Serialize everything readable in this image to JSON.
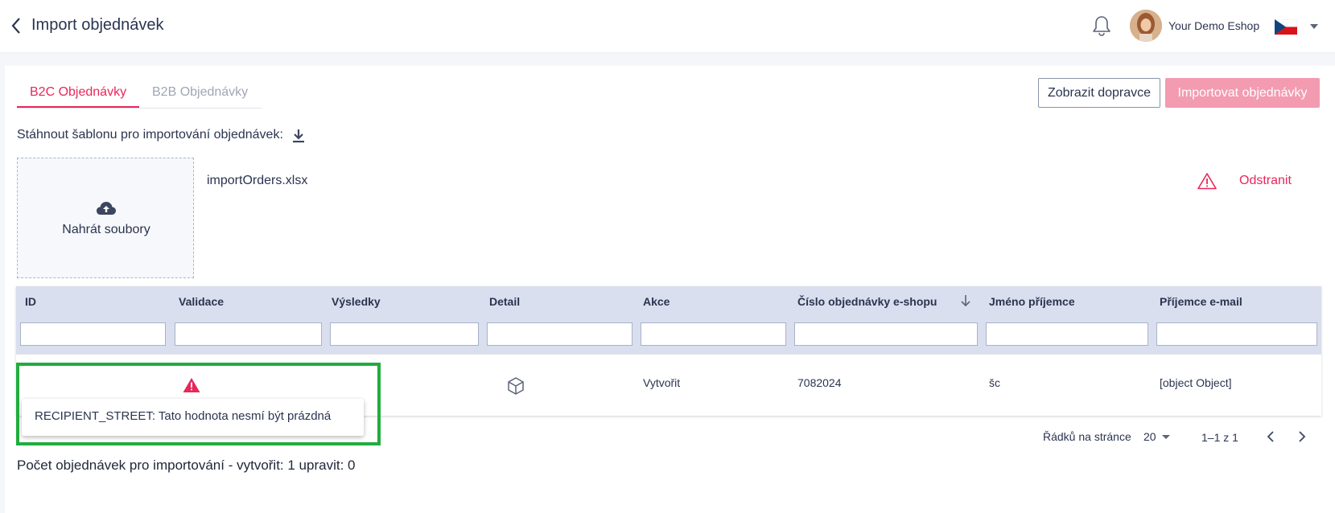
{
  "header": {
    "title": "Import objednávek",
    "shop_name": "Your Demo Eshop",
    "icons": {
      "back": "chevron-left-icon",
      "notifications": "bell-icon",
      "language": "czech-flag-icon"
    }
  },
  "tabs": [
    {
      "label": "B2C Objednávky",
      "active": true
    },
    {
      "label": "B2B Objednávky",
      "active": false
    }
  ],
  "actions": {
    "show_carriers": "Zobrazit dopravce",
    "import_orders": "Importovat objednávky"
  },
  "template": {
    "label": "Stáhnout šablonu pro importování objednávek:",
    "icon": "download-icon"
  },
  "upload": {
    "label": "Nahrát soubory",
    "icon": "cloud-upload-icon"
  },
  "file": {
    "name": "importOrders.xlsx",
    "remove_label": "Odstranit",
    "status_icon": "warning-icon"
  },
  "table": {
    "columns": [
      "ID",
      "Validace",
      "Výsledky",
      "Detail",
      "Akce",
      "Číslo objednávky e-shopu",
      "Jméno příjemce",
      "Příjemce e-mail"
    ],
    "sorted_column": "Číslo objednávky e-shopu",
    "sort_direction": "desc",
    "rows": [
      {
        "id": "",
        "validation_icon": "warning-icon",
        "results": "",
        "detail_icon": "package-icon",
        "action": "Vytvořit",
        "order_number": "7082024",
        "recipient_name": "šc",
        "recipient_email": "[object Object]"
      }
    ],
    "tooltip": "RECIPIENT_STREET: Tato hodnota nesmí být prázdná"
  },
  "pagination": {
    "rows_per_page_label": "Řádků na stránce",
    "rows_per_page": "20",
    "range": "1–1 z 1"
  },
  "summary": "Počet objednávek pro importování - vytvořit: 1 upravit: 0",
  "colors": {
    "accent": "#e8275a",
    "accent_disabled": "#f39bb1",
    "table_header": "#d9dfee",
    "highlight": "#22ac3e"
  }
}
